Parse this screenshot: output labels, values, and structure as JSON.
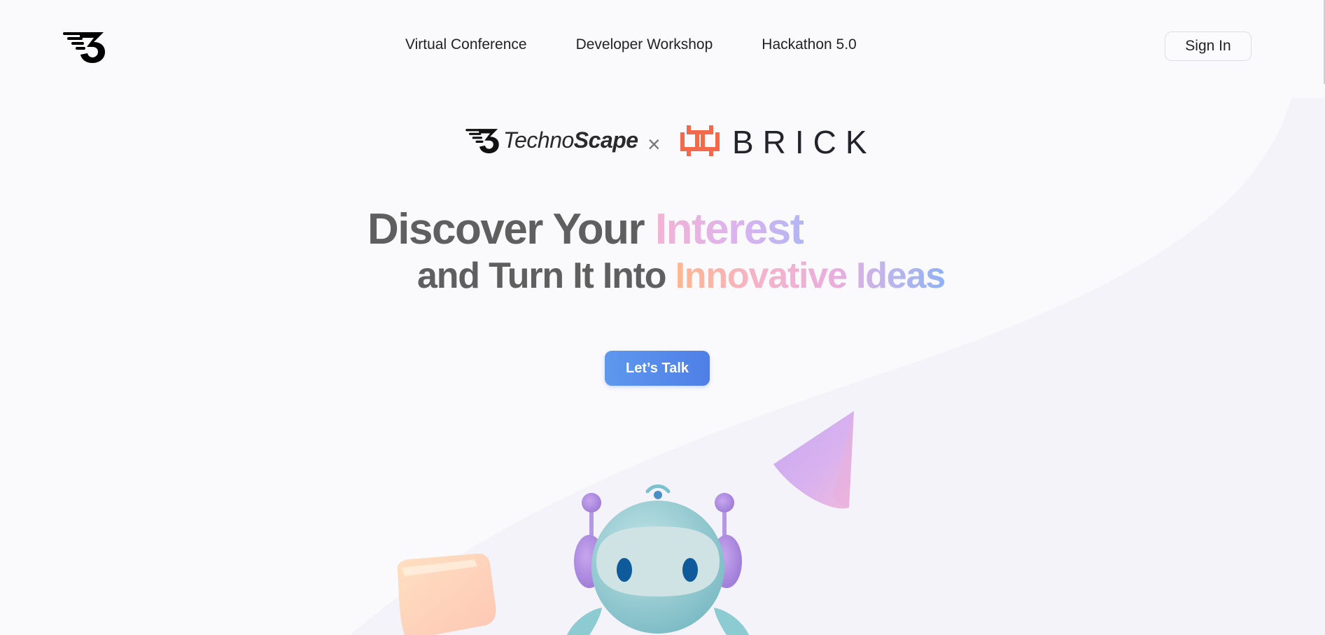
{
  "nav": {
    "links": [
      {
        "label": "Virtual Conference"
      },
      {
        "label": "Developer Workshop"
      },
      {
        "label": "Hackathon 5.0"
      }
    ],
    "signin_label": "Sign In"
  },
  "partners": {
    "technoscape_light": "Techno",
    "technoscape_bold": "Scape",
    "separator": "×",
    "brick": "BRICK"
  },
  "hero": {
    "line1_plain": "Discover Your ",
    "line1_accent": "Interest",
    "line2_plain": "and Turn It Into ",
    "line2_accent": "Innovative Ideas",
    "cta_label": "Let’s Talk"
  },
  "colors": {
    "brand_brick": "#f26a4b",
    "cta_start": "#5e98ee",
    "cta_end": "#4f7fe6",
    "heading": "#5f5f5f"
  },
  "icons": {
    "nav_logo": "technoscape-logo-icon",
    "brick_logo": "brick-logo-icon",
    "robot": "robot-illustration",
    "cone": "cone-shape",
    "cube": "cube-shape"
  }
}
